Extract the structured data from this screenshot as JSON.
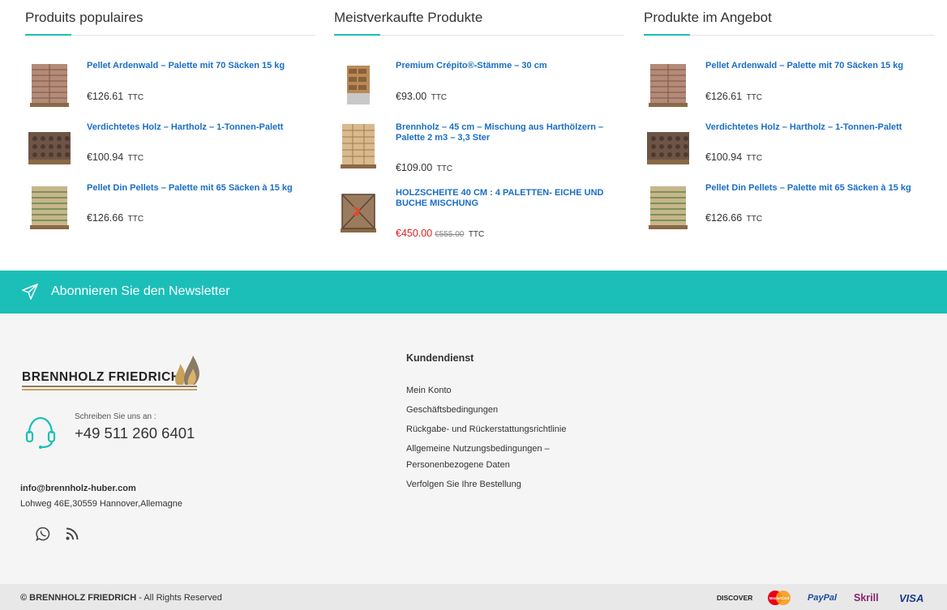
{
  "columns": [
    {
      "title": "Produits populaires",
      "products": [
        {
          "name": "Pellet Ardenwald – Palette mit 70 Säcken 15 kg",
          "price": "€126.61",
          "ttc": "TTC"
        },
        {
          "name": "Verdichtetes Holz – Hartholz – 1-Tonnen-Palett",
          "price": "€100.94",
          "ttc": "TTC"
        },
        {
          "name": "Pellet Din Pellets – Palette mit 65 Säcken à 15 kg",
          "price": "€126.66",
          "ttc": "TTC"
        }
      ]
    },
    {
      "title": "Meistverkaufte Produkte",
      "products": [
        {
          "name": "Premium Crépito®-Stämme – 30 cm",
          "price": "€93.00",
          "ttc": "TTC"
        },
        {
          "name": "Brennholz – 45 cm – Mischung aus Harthölzern – Palette 2 m3 – 3,3 Ster",
          "price": "€109.00",
          "ttc": "TTC"
        },
        {
          "name": "HOLZSCHEITE 40 CM : 4 PALETTEN- EICHE UND BUCHE MISCHUNG",
          "price": "€450.00",
          "old_price": "€555.00",
          "ttc": "TTC"
        }
      ]
    },
    {
      "title": "Produkte im Angebot",
      "products": [
        {
          "name": "Pellet Ardenwald – Palette mit 70 Säcken 15 kg",
          "price": "€126.61",
          "ttc": "TTC"
        },
        {
          "name": "Verdichtetes Holz – Hartholz – 1-Tonnen-Palett",
          "price": "€100.94",
          "ttc": "TTC"
        },
        {
          "name": "Pellet Din Pellets – Palette mit 65 Säcken à 15 kg",
          "price": "€126.66",
          "ttc": "TTC"
        }
      ]
    }
  ],
  "newsletter": {
    "label": "Abonnieren Sie den Newsletter",
    "icon": "paper-plane-icon"
  },
  "footer": {
    "brand": "BRENNHOLZ FRIEDRICH",
    "call_label": "Schreiben Sie uns an :",
    "phone": "+49 511 260 6401",
    "email": "info@brennholz-huber.com",
    "address": "Lohweg 46E,30559 Hannover,Allemagne",
    "social": [
      "whatsapp-icon",
      "rss-icon"
    ],
    "service_title": "Kundendienst",
    "service_links": [
      "Mein Konto",
      "Geschäftsbedingungen",
      "Rückgabe- und Rückerstattungsrichtlinie",
      "Allgemeine Nutzungsbedingungen – Personenbezogene Daten",
      "Verfolgen Sie Ihre Bestellung"
    ]
  },
  "bottom": {
    "copyright_brand": "© BRENNHOLZ FRIEDRICH",
    "copyright_rest": " - All Rights Reserved",
    "payments": [
      "DISCOVER",
      "MasterCard",
      "PayPal",
      "Skrill",
      "VISA"
    ]
  },
  "colors": {
    "accent": "#1bbfb8",
    "link": "#1a6ec6",
    "sale": "#e01e1e"
  }
}
